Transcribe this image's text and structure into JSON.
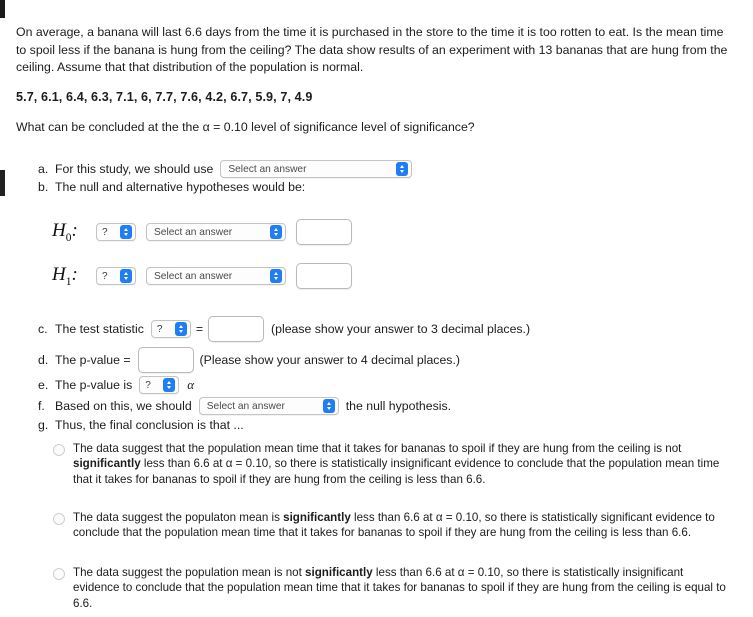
{
  "problem": {
    "intro": "On average, a banana will last 6.6 days from the time it is purchased in the store to the time it is too rotten to eat.  Is the mean time to spoil less if the banana is hung from the ceiling? The data show results of an experiment with 13 bananas that are hung from the ceiling. Assume that that distribution of the population is normal.",
    "data_values": "5.7, 6.1, 6.4, 6.3, 7.1, 6, 7.7, 7.6, 4.2, 6.7, 5.9, 7, 4.9",
    "question": "What can be concluded at the the α = 0.10 level of significance level of significance?"
  },
  "parts": {
    "a": {
      "letter": "a.",
      "text": "For this study, we should use",
      "select_value": "Select an answer"
    },
    "b": {
      "letter": "b.",
      "text": "The null and alternative hypotheses would be:"
    },
    "c": {
      "letter": "c.",
      "text": "The test statistic",
      "select_value": "?",
      "equals": "=",
      "input_value": "",
      "note": "(please show your answer to 3 decimal places.)"
    },
    "d": {
      "letter": "d.",
      "text": "The p-value =",
      "input_value": "",
      "note": "(Please show your answer to 4 decimal places.)"
    },
    "e": {
      "letter": "e.",
      "text": "The p-value is",
      "select_value": "?",
      "alpha": "α"
    },
    "f": {
      "letter": "f.",
      "text": "Based on this, we should",
      "select_value": "Select an answer",
      "text_after": "the null hypothesis."
    },
    "g": {
      "letter": "g.",
      "text": "Thus, the final conclusion is that ..."
    }
  },
  "hypotheses": [
    {
      "label": "H",
      "subscript": "0",
      "colon": ":",
      "comparator_value": "?",
      "parameter_value": "Select an answer",
      "input_value": ""
    },
    {
      "label": "H",
      "subscript": "1",
      "colon": ":",
      "comparator_value": "?",
      "parameter_value": "Select an answer",
      "input_value": ""
    }
  ],
  "conclusion_options": [
    {
      "seg1": "The data suggest that the population mean time that it takes for bananas to spoil if they are hung from the ceiling is not ",
      "bold": "significantly",
      "seg2": " less than 6.6 at α = 0.10, so there is statistically insignificant evidence to conclude that the population mean time that it takes for bananas to spoil if they are hung from the ceiling is less than 6.6.",
      "selected": false
    },
    {
      "seg1": "The data suggest the populaton mean is ",
      "bold": "significantly",
      "seg2": " less than 6.6 at α = 0.10, so there is statistically significant evidence to conclude that the population mean time that it takes for bananas to spoil if they are hung from the ceiling is less than 6.6.",
      "selected": false
    },
    {
      "seg1": "The data suggest the population mean is not ",
      "bold": "significantly",
      "seg2": " less than 6.6 at α = 0.10, so there is statistically insignificant evidence to conclude that the population mean time that it takes for bananas to spoil if they are hung from the ceiling is equal to 6.6.",
      "selected": false
    }
  ],
  "colors": {
    "accent_blue": "#1f7ef5",
    "text": "#1c1c1c",
    "border_gray": "#c4c4c4",
    "background": "#ffffff"
  }
}
